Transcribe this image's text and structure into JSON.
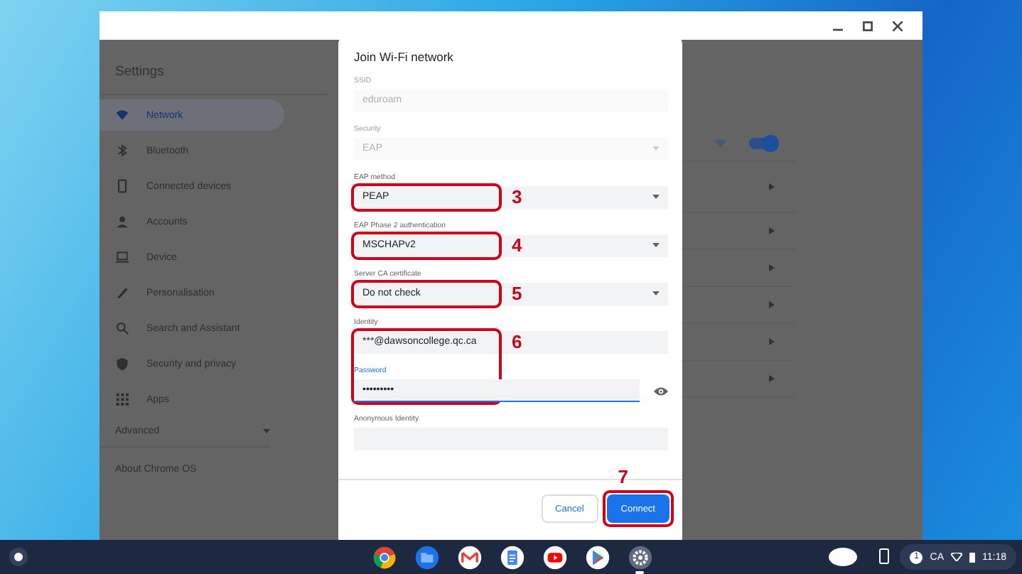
{
  "settings": {
    "title": "Settings",
    "sidebar": [
      {
        "label": "Network",
        "selected": true
      },
      {
        "label": "Bluetooth",
        "selected": false
      },
      {
        "label": "Connected devices",
        "selected": false
      },
      {
        "label": "Accounts",
        "selected": false
      },
      {
        "label": "Device",
        "selected": false
      },
      {
        "label": "Personalisation",
        "selected": false
      },
      {
        "label": "Search and Assistant",
        "selected": false
      },
      {
        "label": "Security and privacy",
        "selected": false
      },
      {
        "label": "Apps",
        "selected": false
      }
    ],
    "advanced": {
      "label": "Advanced",
      "expanded": false
    },
    "about": "About Chrome OS",
    "wifi_toggle": {
      "on": true
    }
  },
  "dialog": {
    "title": "Join Wi-Fi network",
    "fields": [
      {
        "label": "SSID",
        "kind": "text",
        "value": "eduroam",
        "disabled": true,
        "focused": false
      },
      {
        "label": "Security",
        "kind": "select",
        "value": "EAP",
        "disabled": true,
        "focused": false
      },
      {
        "label": "EAP method",
        "kind": "select",
        "value": "PEAP",
        "disabled": false,
        "focused": false
      },
      {
        "label": "EAP Phase 2 authentication",
        "kind": "select",
        "value": "MSCHAPv2",
        "disabled": false,
        "focused": false
      },
      {
        "label": "Server CA certificate",
        "kind": "select",
        "value": "Do not check",
        "disabled": false,
        "focused": false
      },
      {
        "label": "Identity",
        "kind": "text",
        "value": "***@dawsoncollege.qc.ca",
        "disabled": false,
        "focused": false
      },
      {
        "label": "Password",
        "kind": "password",
        "value": "•••••••••",
        "disabled": false,
        "focused": true
      },
      {
        "label": "Anonymous Identity",
        "kind": "text",
        "focused": false
      }
    ],
    "buttons": [
      {
        "label": "Cancel",
        "kind": "secondary"
      },
      {
        "label": "Connect",
        "kind": "primary"
      }
    ]
  },
  "annotations": [
    {
      "label": "3"
    },
    {
      "label": "4"
    },
    {
      "label": "5"
    },
    {
      "label": "6"
    },
    {
      "label": "7"
    }
  ],
  "shelf": {
    "apps": [
      {
        "kind": "chrome",
        "active": false
      },
      {
        "kind": "files",
        "active": false
      },
      {
        "kind": "gmail",
        "active": false
      },
      {
        "kind": "docs",
        "active": false
      },
      {
        "kind": "youtube",
        "active": false
      },
      {
        "kind": "play",
        "active": false
      },
      {
        "kind": "settings",
        "active": true
      }
    ],
    "status": {
      "notifications": "1",
      "keyboard": "CA",
      "time": "11:18"
    }
  }
}
